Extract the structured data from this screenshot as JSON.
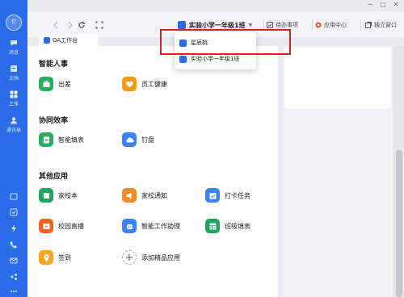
{
  "sidebar": {
    "avatar_text": "钉",
    "items": [
      {
        "label": "消息"
      },
      {
        "label": "文档"
      },
      {
        "label": "工作"
      },
      {
        "label": "通讯录"
      }
    ]
  },
  "topbar": {
    "org_name": "实验小学一年级1班",
    "links": {
      "todo": "待办事项",
      "app_center": "应用中心",
      "standalone": "独立窗口"
    }
  },
  "tab": {
    "label": "OA工作台"
  },
  "sections": [
    {
      "title": "智能人事",
      "apps": [
        {
          "label": "出差",
          "color": "#27ae60"
        },
        {
          "label": "员工健康",
          "color": "#f39c12"
        }
      ]
    },
    {
      "title": "协同效率",
      "apps": [
        {
          "label": "智能填表",
          "color": "#27ae60"
        },
        {
          "label": "钉盘",
          "color": "#3b82f6"
        }
      ]
    },
    {
      "title": "其他应用",
      "apps": [
        {
          "label": "家校本",
          "color": "#1fa463"
        },
        {
          "label": "家校通知",
          "color": "#f08c2a"
        },
        {
          "label": "打卡任务",
          "color": "#3b82f6"
        },
        {
          "label": "校园直播",
          "color": "#f0641f"
        },
        {
          "label": "智能工作助理",
          "color": "#3b82f6"
        },
        {
          "label": "班级填表",
          "color": "#1fa463"
        },
        {
          "label": "签到",
          "color": "#f5a623"
        },
        {
          "label": "添加精品应用",
          "color": "#9aa3b0"
        }
      ]
    }
  ],
  "dropdown": {
    "items": [
      {
        "label": "星辰桃"
      },
      {
        "label": "实验小学一年级1班"
      }
    ]
  },
  "colors": {
    "brand": "#2a6be8",
    "highlight": "#e02020"
  }
}
